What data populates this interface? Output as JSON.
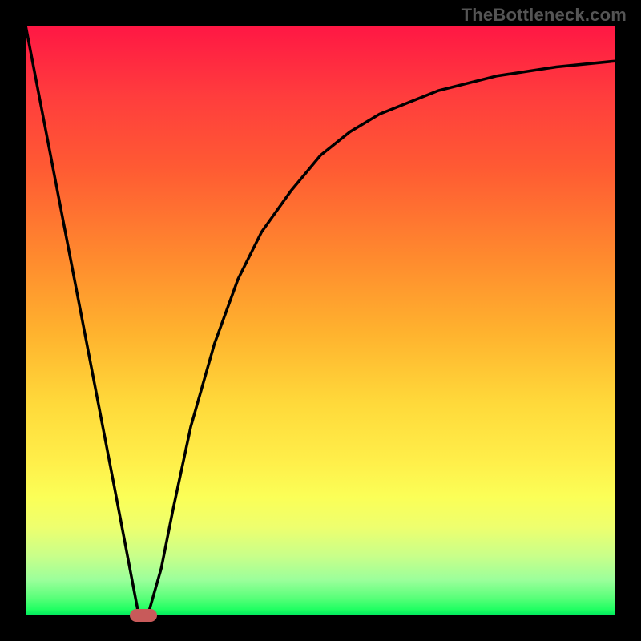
{
  "watermark": "TheBottleneck.com",
  "colors": {
    "frame": "#000000",
    "gradient_top": "#ff1744",
    "gradient_bottom": "#00e85e",
    "curve": "#000000",
    "marker": "#c85a5a"
  },
  "chart_data": {
    "type": "line",
    "title": "",
    "xlabel": "",
    "ylabel": "",
    "xlim": [
      0,
      100
    ],
    "ylim": [
      0,
      100
    ],
    "x": [
      0,
      5,
      10,
      15,
      19,
      20,
      21,
      23,
      25,
      28,
      32,
      36,
      40,
      45,
      50,
      55,
      60,
      70,
      80,
      90,
      100
    ],
    "values": [
      100,
      74,
      48,
      22,
      1,
      0,
      1,
      8,
      18,
      32,
      46,
      57,
      65,
      72,
      78,
      82,
      85,
      89,
      91.5,
      93,
      94
    ],
    "marker": {
      "x": 20,
      "y": 0
    },
    "annotations": []
  }
}
